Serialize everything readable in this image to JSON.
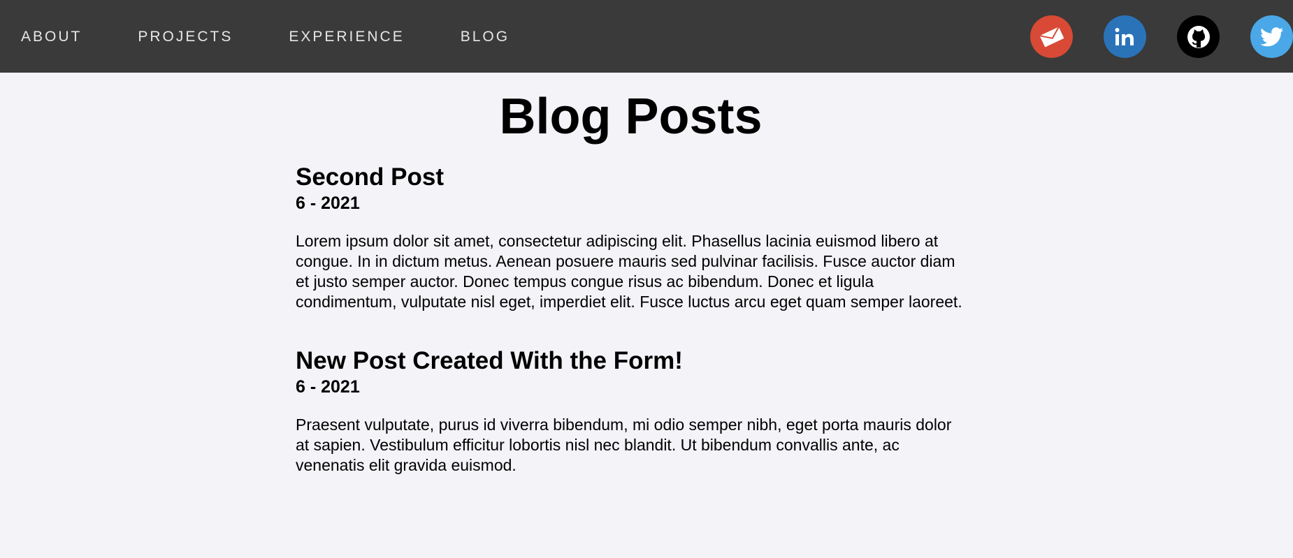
{
  "nav": {
    "links": [
      {
        "label": "ABOUT"
      },
      {
        "label": "PROJECTS"
      },
      {
        "label": "EXPERIENCE"
      },
      {
        "label": "BLOG"
      }
    ],
    "social": [
      {
        "name": "email",
        "icon": "mail-icon",
        "color": "#d84a35"
      },
      {
        "name": "linkedin",
        "icon": "linkedin-icon",
        "color": "#2a73b9"
      },
      {
        "name": "github",
        "icon": "github-icon",
        "color": "#000000"
      },
      {
        "name": "twitter",
        "icon": "twitter-icon",
        "color": "#4aa8e8"
      }
    ]
  },
  "page": {
    "title": "Blog Posts"
  },
  "posts": [
    {
      "title": "Second Post",
      "date": "6 - 2021",
      "body": "Lorem ipsum dolor sit amet, consectetur adipiscing elit. Phasellus lacinia euismod libero at congue. In in dictum metus. Aenean posuere mauris sed pulvinar facilisis. Fusce auctor diam et justo semper auctor. Donec tempus congue risus ac bibendum. Donec et ligula condimentum, vulputate nisl eget, imperdiet elit. Fusce luctus arcu eget quam semper laoreet."
    },
    {
      "title": "New Post Created With the Form!",
      "date": "6 - 2021",
      "body": "Praesent vulputate, purus id viverra bibendum, mi odio semper nibh, eget porta mauris dolor at sapien. Vestibulum efficitur lobortis nisl nec blandit. Ut bibendum convallis ante, ac venenatis elit gravida euismod."
    }
  ],
  "colors": {
    "navbar": "#3a3a3a",
    "background": "#f3f3f8"
  }
}
